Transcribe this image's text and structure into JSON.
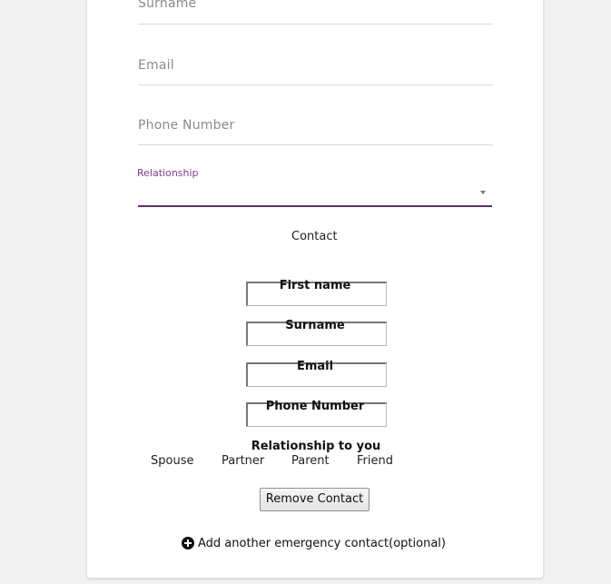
{
  "material_fields": {
    "surname_label": "Surname",
    "email_label": "Email",
    "phone_label": "Phone Number",
    "relationship_label": "Relationship",
    "relationship_value": ""
  },
  "contact_section": {
    "heading": "Contact",
    "first_name_label": "First name",
    "surname_label": "Surname",
    "email_label": "Email",
    "phone_label": "Phone Number",
    "relationship_title": "Relationship to you",
    "relationship_options": [
      "Spouse",
      "Partner",
      "Parent",
      "Friend"
    ],
    "remove_button": "Remove Contact"
  },
  "add_contact_link": "Add another emergency contact(optional)",
  "icons": {
    "dropdown": "chevron-down-icon",
    "add": "plus-circle-icon"
  },
  "colors": {
    "accent": "#7b3a8e",
    "underline_active": "#5b2f69"
  }
}
